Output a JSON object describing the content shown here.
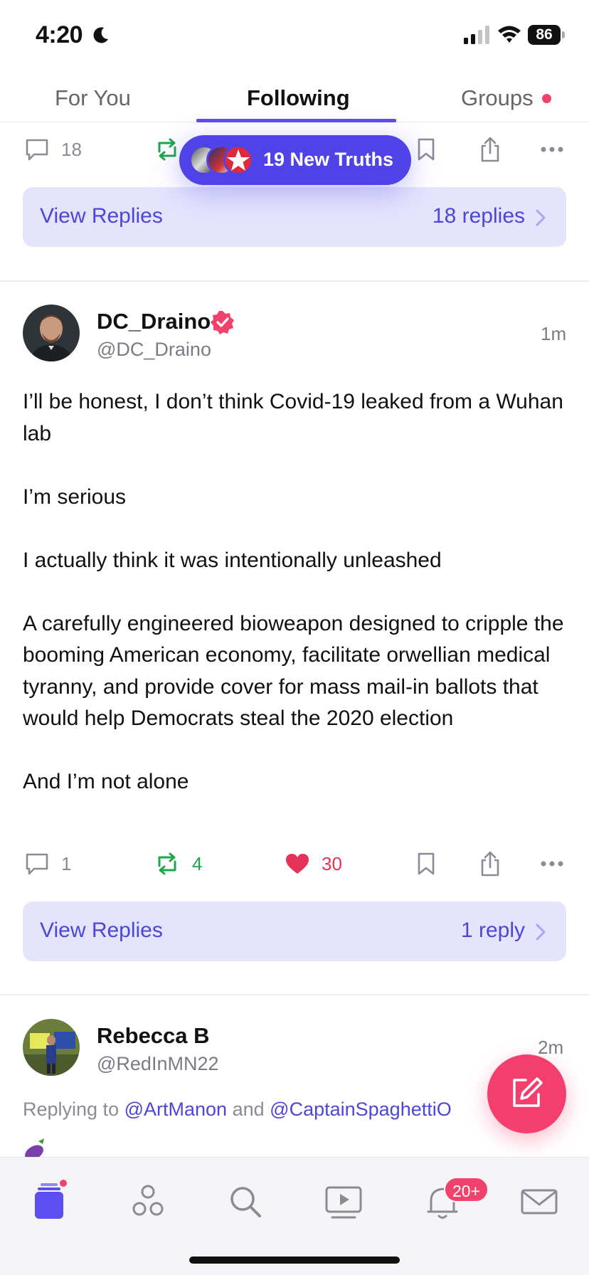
{
  "status_bar": {
    "time": "4:20",
    "battery": "86"
  },
  "top_tabs": [
    {
      "label": "For You",
      "active": false
    },
    {
      "label": "Following",
      "active": true
    },
    {
      "label": "Groups",
      "active": false,
      "has_dot": true
    }
  ],
  "new_truths_pill": {
    "label": "19 New Truths"
  },
  "previous_post": {
    "actions": {
      "replies": "18"
    },
    "view_replies": {
      "label": "View Replies",
      "count": "18 replies"
    }
  },
  "post": {
    "display_name": "DC_Draino",
    "handle": "@DC_Draino",
    "time": "1m",
    "verified": true,
    "paragraphs": [
      "I’ll be honest, I don’t think Covid-19 leaked from a Wuhan lab",
      "I’m serious",
      "I actually think it was intentionally unleashed",
      "A carefully engineered bioweapon designed to cripple the booming American economy, facilitate orwellian medical tyranny, and provide cover for mass mail-in ballots that would help Democrats steal the 2020 election",
      "And I’m not alone"
    ],
    "actions": {
      "replies": "1",
      "retruths": "4",
      "likes": "30"
    },
    "view_replies": {
      "label": "View Replies",
      "count": "1 reply"
    }
  },
  "next_post": {
    "display_name": "Rebecca B",
    "handle": "@RedInMN22",
    "time": "2m",
    "replying_prefix": "Replying to",
    "replying_join": "and",
    "mentions": [
      "@ArtManon",
      "@CaptainSpaghettiO"
    ]
  },
  "bottom_nav": {
    "items": [
      "home-icon",
      "groups-icon",
      "search-icon",
      "video-icon",
      "notifications-icon",
      "messages-icon"
    ],
    "notification_badge": "20+"
  },
  "colors": {
    "accent": "#5c4ef0",
    "retruth_green": "#1fa54a",
    "like_pink": "#e5325a",
    "fab": "#f43f6e",
    "replies_bg": "#e4e4fd"
  }
}
